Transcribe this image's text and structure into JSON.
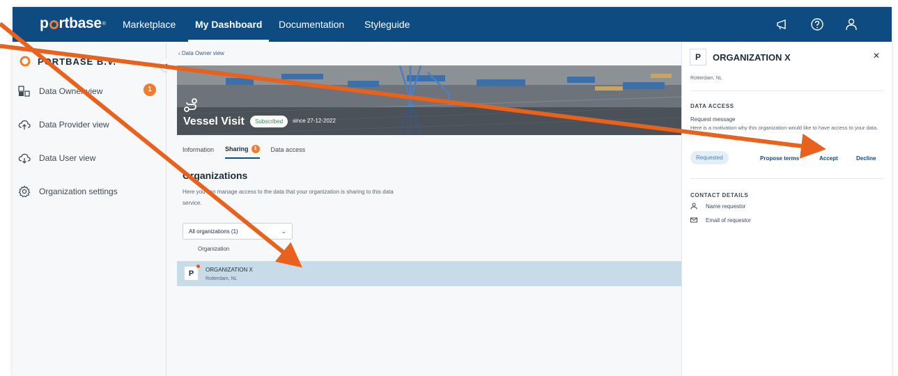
{
  "topnav": {
    "logo": "portbase",
    "items": [
      "Marketplace",
      "My Dashboard",
      "Documentation",
      "Styleguide"
    ],
    "active_index": 1
  },
  "sidebar": {
    "org_name": "PORTBASE B.V.",
    "items": [
      {
        "label": "Data Owner view",
        "icon": "data-owner-icon",
        "badge": "1"
      },
      {
        "label": "Data Provider view",
        "icon": "cloud-upload-icon"
      },
      {
        "label": "Data User view",
        "icon": "cloud-download-icon"
      },
      {
        "label": "Organization settings",
        "icon": "gear-icon"
      }
    ]
  },
  "main": {
    "back_link": "Data Owner view",
    "hero": {
      "title": "Vessel Visit",
      "status": "Subscribed",
      "since": "since 27-12-2022"
    },
    "tabs": [
      {
        "label": "Information"
      },
      {
        "label": "Sharing",
        "badge": "1",
        "active": true
      },
      {
        "label": "Data access"
      }
    ],
    "section_title": "Organizations",
    "section_desc": "Here you can manage access to the data that your organization is sharing to this data service.",
    "filter": {
      "value": "All organizations (1)"
    },
    "column_header": "Organization",
    "rows": [
      {
        "avatar": "P",
        "name": "ORGANIZATION X",
        "location": "Rotterdam, NL"
      }
    ]
  },
  "panel": {
    "avatar": "P",
    "title": "ORGANIZATION X",
    "location": "Rotterdam, NL",
    "data_access_label": "DATA ACCESS",
    "request_title": "Request message",
    "request_message": "Here is a motivation why this organization would like to have access to your data.",
    "status_pill": "Requested",
    "actions": {
      "propose": "Propose terms",
      "accept": "Accept",
      "decline": "Decline"
    },
    "contact_label": "CONTACT DETAILS",
    "contact_name": "Name requestor",
    "contact_email": "Email of requestor"
  },
  "colors": {
    "navbar": "#0d4b80",
    "accent": "#f07d2c",
    "selected_row": "#c7dbe9",
    "annotation_arrow": "#e8621e"
  }
}
